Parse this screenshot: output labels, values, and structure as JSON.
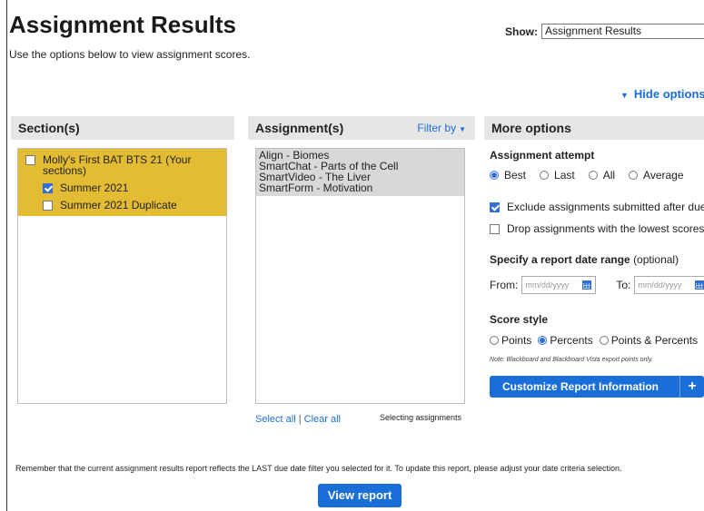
{
  "header": {
    "title": "Assignment Results",
    "subtitle": "Use the options below to view assignment scores.",
    "show_label": "Show:",
    "show_value": "Assignment Results",
    "hide_options": "Hide options"
  },
  "sections": {
    "heading": "Section(s)",
    "parent": {
      "label": "Molly's First BAT BTS 21  (Your sections)",
      "checked": false
    },
    "children": [
      {
        "label": "Summer 2021",
        "checked": true
      },
      {
        "label": "Summer 2021 Duplicate",
        "checked": false
      }
    ],
    "highlight_color": "#e3bc33"
  },
  "assignments": {
    "heading": "Assignment(s)",
    "filter_by": "Filter by",
    "items": [
      "Align - Biomes",
      "SmartChat - Parts of the Cell",
      "SmartVideo - The Liver",
      "SmartForm - Motivation"
    ],
    "select_all": "Select all",
    "separator": "|",
    "clear_all": "Clear all",
    "status": "Selecting assignments"
  },
  "more_options": {
    "heading": "More options",
    "attempt_heading": "Assignment attempt",
    "attempts": [
      {
        "label": "Best",
        "selected": true
      },
      {
        "label": "Last",
        "selected": false
      },
      {
        "label": "All",
        "selected": false
      },
      {
        "label": "Average",
        "selected": false
      }
    ],
    "exclude_label": "Exclude assignments submitted after due date",
    "exclude_checked": true,
    "drop_label": "Drop assignments with the lowest scores",
    "drop_checked": false,
    "date_range_heading": "Specify a report date range",
    "date_range_optional": "(optional)",
    "from_label": "From:",
    "to_label": "To:",
    "date_placeholder": "mm/dd/yyyy",
    "score_style_heading": "Score style",
    "score_styles": [
      {
        "label": "Points",
        "selected": false
      },
      {
        "label": "Percents",
        "selected": true
      },
      {
        "label": "Points & Percents",
        "selected": false
      }
    ],
    "note": "Note: Blackboard and Blackboard Vista export points only.",
    "customize_label": "Customize Report Information",
    "customize_plus": "+"
  },
  "footer": {
    "reminder": "Remember that the current assignment results report reflects the LAST due date filter you selected for it. To update this report, please adjust your date criteria selection.",
    "view_report": "View report"
  },
  "colors": {
    "accent": "#1a6ed8",
    "header_bg": "#e6e6e6",
    "list_bg": "#d8d8d8"
  },
  "icons": [
    "dropdown-caret-icon",
    "triangle-down-icon",
    "calendar-icon",
    "plus-icon"
  ]
}
